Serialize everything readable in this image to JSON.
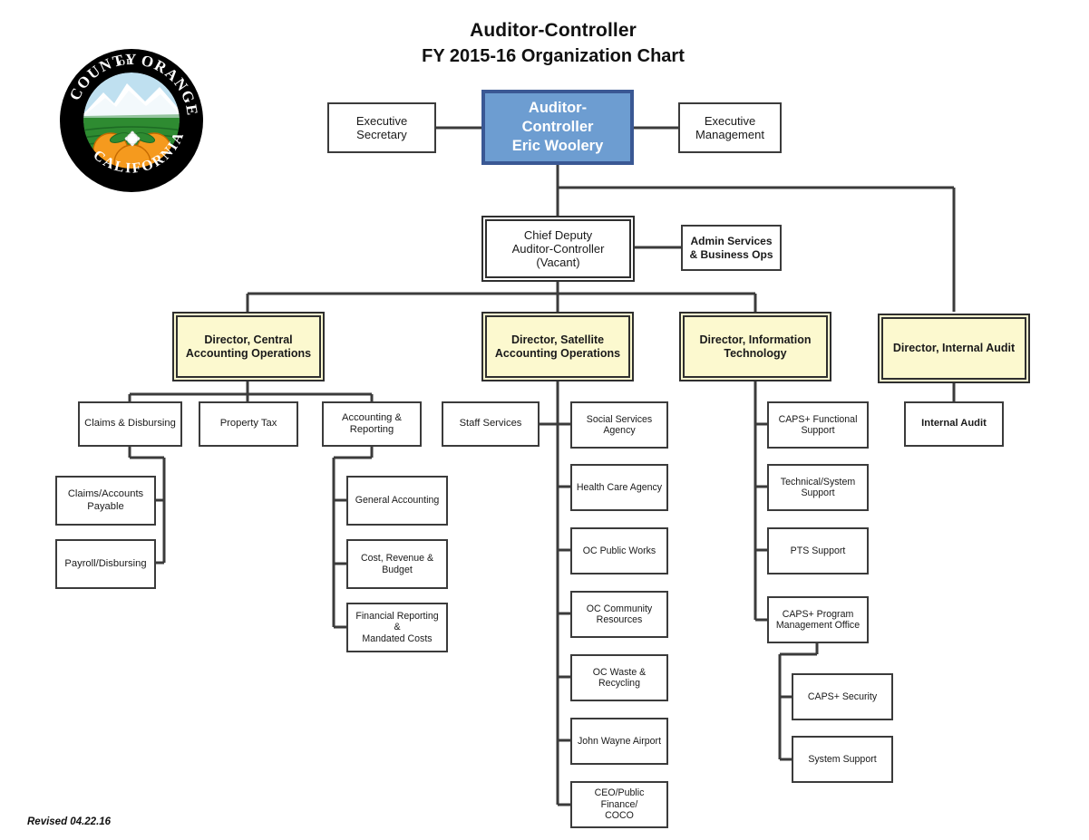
{
  "header": {
    "title_line1": "Auditor-Controller",
    "title_line2": "FY 2015-16 Organization Chart"
  },
  "seal": {
    "name": "county-of-orange-seal",
    "top_text": "COUNTY",
    "mid_text": "OF",
    "right_text": "ORANGE",
    "bottom_text": "CALIFORNIA"
  },
  "footer": {
    "revised": "Revised 04.22.16"
  },
  "colors": {
    "executive_fill": "#6d9dd1",
    "executive_border": "#3a5894",
    "director_fill": "#fcf9cf",
    "box_border": "#3b3b3b",
    "connector": "#3b3b3b",
    "text": "#1a1a1a"
  },
  "nodes": {
    "executive_secretary": "Executive\nSecretary",
    "auditor_controller": "Auditor-\nController\nEric Woolery",
    "executive_management": "Executive\nManagement",
    "chief_deputy": "Chief Deputy\nAuditor-Controller\n(Vacant)",
    "admin_services": "Admin Services\n& Business Ops",
    "dir_central": "Director, Central\nAccounting Operations",
    "dir_satellite": "Director, Satellite\nAccounting Operations",
    "dir_it": "Director, Information\nTechnology",
    "dir_audit": "Director, Internal Audit",
    "claims_disbursing": "Claims & Disbursing",
    "property_tax": "Property Tax",
    "accounting_reporting": "Accounting &\nReporting",
    "claims_accounts_payable": "Claims/Accounts\nPayable",
    "payroll_disbursing": "Payroll/Disbursing",
    "general_accounting": "General Accounting",
    "cost_revenue_budget": "Cost, Revenue &\nBudget",
    "financial_reporting": "Financial Reporting &\nMandated Costs",
    "staff_services": "Staff Services",
    "social_services_agency": "Social Services\nAgency",
    "health_care_agency": "Health Care Agency",
    "oc_public_works": "OC Public Works",
    "oc_community_resources": "OC Community\nResources",
    "oc_waste_recycling": "OC Waste &\nRecycling",
    "john_wayne_airport": "John Wayne Airport",
    "ceo_public_finance": "CEO/Public Finance/\nCOCO",
    "caps_functional_support": "CAPS+ Functional\nSupport",
    "technical_system_support": "Technical/System\nSupport",
    "pts_support": "PTS Support",
    "caps_program_mgmt": "CAPS+ Program\nManagement Office",
    "caps_security": "CAPS+ Security",
    "system_support": "System Support",
    "internal_audit": "Internal Audit"
  },
  "chart_data": {
    "type": "diagram",
    "title": "Auditor-Controller FY 2015-16 Organization Chart",
    "root": "Auditor-Controller Eric Woolery",
    "hierarchy": [
      {
        "name": "Auditor-Controller Eric Woolery",
        "level": 0,
        "parent": null,
        "peers": [
          "Executive Secretary",
          "Executive Management"
        ]
      },
      {
        "name": "Chief Deputy Auditor-Controller (Vacant)",
        "level": 1,
        "parent": "Auditor-Controller Eric Woolery",
        "peers": [
          "Admin Services & Business Ops"
        ]
      },
      {
        "name": "Director, Central Accounting Operations",
        "level": 2,
        "parent": "Chief Deputy Auditor-Controller (Vacant)"
      },
      {
        "name": "Director, Satellite Accounting Operations",
        "level": 2,
        "parent": "Chief Deputy Auditor-Controller (Vacant)"
      },
      {
        "name": "Director, Information Technology",
        "level": 2,
        "parent": "Chief Deputy Auditor-Controller (Vacant)"
      },
      {
        "name": "Director, Internal Audit",
        "level": 2,
        "parent": "Auditor-Controller Eric Woolery"
      },
      {
        "name": "Claims & Disbursing",
        "level": 3,
        "parent": "Director, Central Accounting Operations"
      },
      {
        "name": "Property Tax",
        "level": 3,
        "parent": "Director, Central Accounting Operations"
      },
      {
        "name": "Accounting & Reporting",
        "level": 3,
        "parent": "Director, Central Accounting Operations"
      },
      {
        "name": "Claims/Accounts Payable",
        "level": 4,
        "parent": "Claims & Disbursing"
      },
      {
        "name": "Payroll/Disbursing",
        "level": 4,
        "parent": "Claims & Disbursing"
      },
      {
        "name": "General Accounting",
        "level": 4,
        "parent": "Accounting & Reporting"
      },
      {
        "name": "Cost, Revenue & Budget",
        "level": 4,
        "parent": "Accounting & Reporting"
      },
      {
        "name": "Financial Reporting & Mandated Costs",
        "level": 4,
        "parent": "Accounting & Reporting"
      },
      {
        "name": "Staff Services",
        "level": 3,
        "parent": "Director, Satellite Accounting Operations"
      },
      {
        "name": "Social Services Agency",
        "level": 3,
        "parent": "Director, Satellite Accounting Operations"
      },
      {
        "name": "Health Care Agency",
        "level": 3,
        "parent": "Director, Satellite Accounting Operations"
      },
      {
        "name": "OC Public Works",
        "level": 3,
        "parent": "Director, Satellite Accounting Operations"
      },
      {
        "name": "OC Community Resources",
        "level": 3,
        "parent": "Director, Satellite Accounting Operations"
      },
      {
        "name": "OC Waste & Recycling",
        "level": 3,
        "parent": "Director, Satellite Accounting Operations"
      },
      {
        "name": "John Wayne Airport",
        "level": 3,
        "parent": "Director, Satellite Accounting Operations"
      },
      {
        "name": "CEO/Public Finance/COCO",
        "level": 3,
        "parent": "Director, Satellite Accounting Operations"
      },
      {
        "name": "CAPS+ Functional Support",
        "level": 3,
        "parent": "Director, Information Technology"
      },
      {
        "name": "Technical/System Support",
        "level": 3,
        "parent": "Director, Information Technology"
      },
      {
        "name": "PTS Support",
        "level": 3,
        "parent": "Director, Information Technology"
      },
      {
        "name": "CAPS+ Program Management Office",
        "level": 3,
        "parent": "Director, Information Technology"
      },
      {
        "name": "CAPS+ Security",
        "level": 4,
        "parent": "CAPS+ Program Management Office"
      },
      {
        "name": "System Support",
        "level": 4,
        "parent": "CAPS+ Program Management Office"
      },
      {
        "name": "Internal Audit",
        "level": 3,
        "parent": "Director, Internal Audit"
      }
    ]
  }
}
